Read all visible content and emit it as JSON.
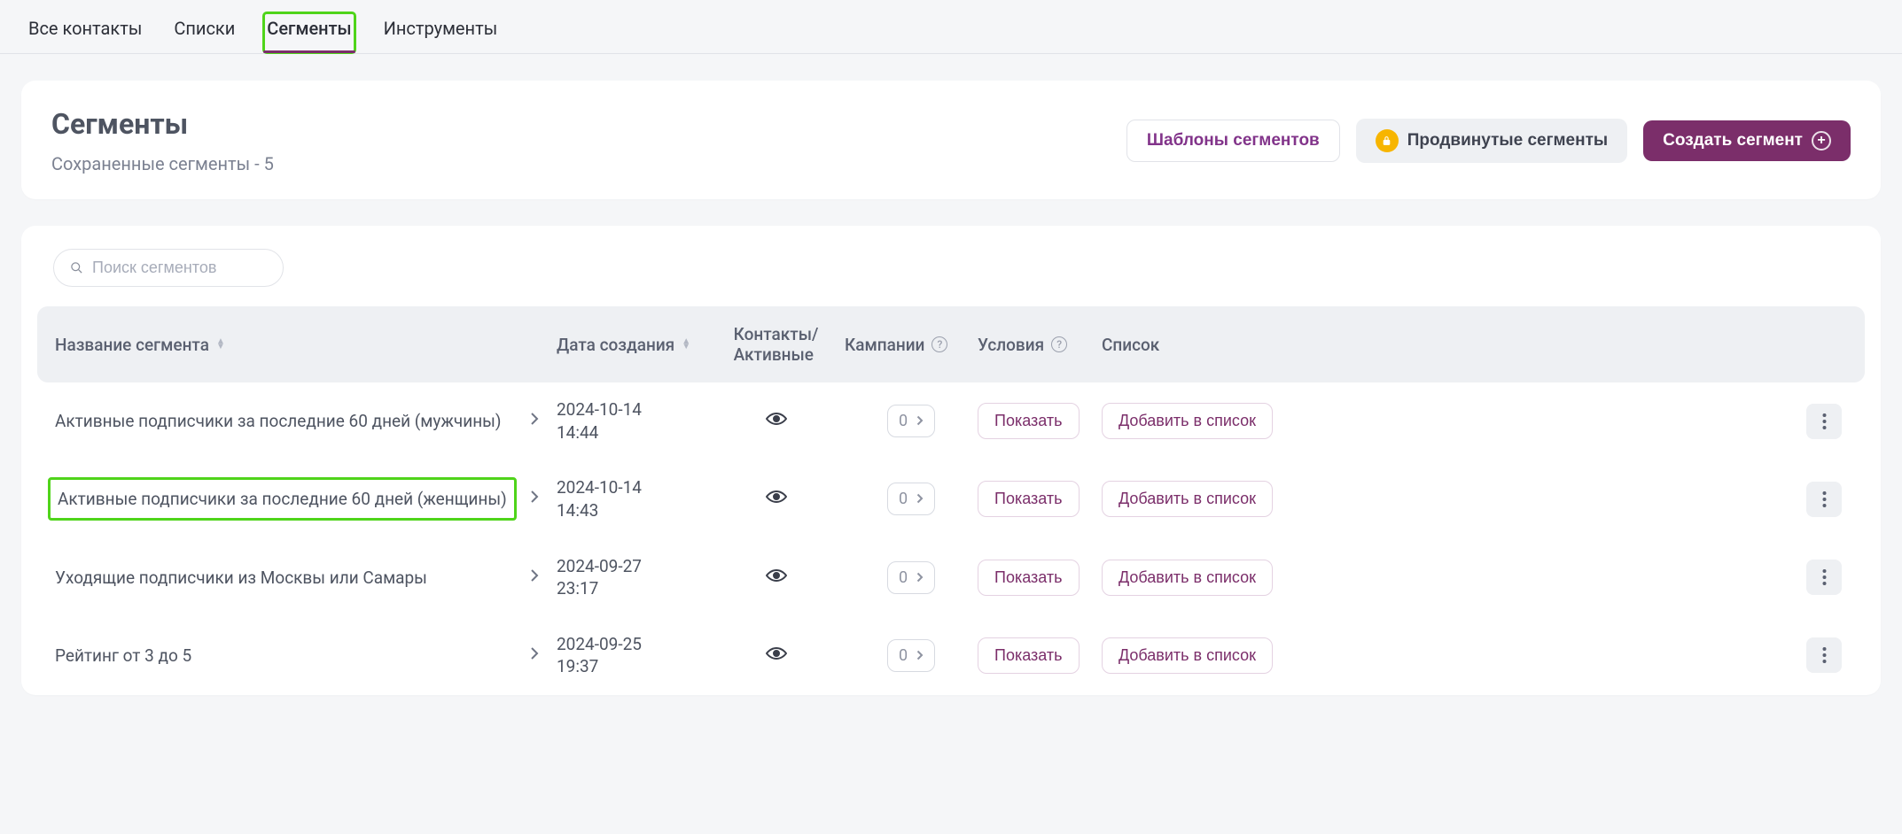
{
  "tabs": {
    "all_contacts": "Все контакты",
    "lists": "Списки",
    "segments": "Сегменты",
    "tools": "Инструменты"
  },
  "header": {
    "title": "Сегменты",
    "subtitle": "Сохраненные сегменты - 5",
    "btn_templates": "Шаблоны сегментов",
    "btn_advanced": "Продвинутые сегменты",
    "btn_create": "Создать сегмент"
  },
  "search": {
    "placeholder": "Поиск сегментов"
  },
  "table": {
    "col_name": "Название сегмента",
    "col_date": "Дата создания",
    "col_contacts_l1": "Контакты/",
    "col_contacts_l2": "Активные",
    "col_campaigns": "Кампании",
    "col_conditions": "Условия",
    "col_list": "Список"
  },
  "buttons": {
    "show": "Показать",
    "add_to_list": "Добавить в список",
    "campaign_count": "0"
  },
  "rows": [
    {
      "name": "Активные подписчики за последние 60 дней (мужчины)",
      "date_l1": "2024-10-14",
      "date_l2": "14:44",
      "highlight": false
    },
    {
      "name": "Активные подписчики за последние 60 дней (женщины)",
      "date_l1": "2024-10-14",
      "date_l2": "14:43",
      "highlight": true
    },
    {
      "name": "Уходящие подписчики из Москвы или Самары",
      "date_l1": "2024-09-27",
      "date_l2": "23:17",
      "highlight": false
    },
    {
      "name": "Рейтинг от 3 до 5",
      "date_l1": "2024-09-25",
      "date_l2": "19:37",
      "highlight": false
    }
  ]
}
